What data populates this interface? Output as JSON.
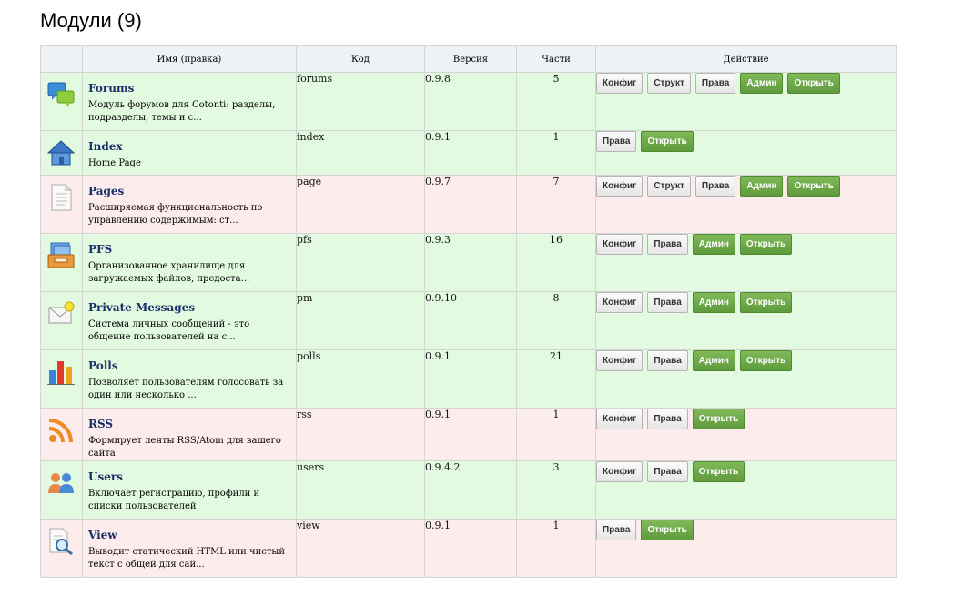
{
  "page_title": "Модули (9)",
  "columns": [
    "Имя (правка)",
    "Код",
    "Версия",
    "Части",
    "Действие"
  ],
  "modules": [
    {
      "name": "Forums",
      "desc": "Модуль форумов для Cotonti: разделы, подразделы, темы и с...",
      "code": "forums",
      "version": "0.9.8",
      "parts": "5",
      "status": "g",
      "icon": "forums-icon",
      "actions": [
        {
          "label": "Конфиг",
          "style": "gray"
        },
        {
          "label": "Структ",
          "style": "gray"
        },
        {
          "label": "Права",
          "style": "gray"
        },
        {
          "label": "Админ",
          "style": "green"
        },
        {
          "label": "Открыть",
          "style": "green"
        }
      ]
    },
    {
      "name": "Index",
      "desc": "Home Page",
      "code": "index",
      "version": "0.9.1",
      "parts": "1",
      "status": "g",
      "icon": "home-icon",
      "actions": [
        {
          "label": "Права",
          "style": "gray"
        },
        {
          "label": "Открыть",
          "style": "green"
        }
      ]
    },
    {
      "name": "Pages",
      "desc": "Расширяемая функциональность по управлению содержимым: ст...",
      "code": "page",
      "version": "0.9.7",
      "parts": "7",
      "status": "r",
      "icon": "page-icon",
      "actions": [
        {
          "label": "Конфиг",
          "style": "gray"
        },
        {
          "label": "Структ",
          "style": "gray"
        },
        {
          "label": "Права",
          "style": "gray"
        },
        {
          "label": "Админ",
          "style": "green"
        },
        {
          "label": "Открыть",
          "style": "green"
        }
      ]
    },
    {
      "name": "PFS",
      "desc": "Организованное хранилище для загружаемых файлов, предоста...",
      "code": "pfs",
      "version": "0.9.3",
      "parts": "16",
      "status": "g",
      "icon": "file-storage-icon",
      "actions": [
        {
          "label": "Конфиг",
          "style": "gray"
        },
        {
          "label": "Права",
          "style": "gray"
        },
        {
          "label": "Админ",
          "style": "green"
        },
        {
          "label": "Открыть",
          "style": "green"
        }
      ]
    },
    {
      "name": "Private Messages",
      "desc": "Система личных сообщений - это общение пользователей на с...",
      "code": "pm",
      "version": "0.9.10",
      "parts": "8",
      "status": "g",
      "icon": "envelope-icon",
      "actions": [
        {
          "label": "Конфиг",
          "style": "gray"
        },
        {
          "label": "Права",
          "style": "gray"
        },
        {
          "label": "Админ",
          "style": "green"
        },
        {
          "label": "Открыть",
          "style": "green"
        }
      ]
    },
    {
      "name": "Polls",
      "desc": "Позволяет пользователям голосовать за один или несколько ...",
      "code": "polls",
      "version": "0.9.1",
      "parts": "21",
      "status": "g",
      "icon": "bar-chart-icon",
      "actions": [
        {
          "label": "Конфиг",
          "style": "gray"
        },
        {
          "label": "Права",
          "style": "gray"
        },
        {
          "label": "Админ",
          "style": "green"
        },
        {
          "label": "Открыть",
          "style": "green"
        }
      ]
    },
    {
      "name": "RSS",
      "desc": "Формирует ленты RSS/Atom для вашего сайта",
      "code": "rss",
      "version": "0.9.1",
      "parts": "1",
      "status": "r",
      "icon": "rss-icon",
      "actions": [
        {
          "label": "Конфиг",
          "style": "gray"
        },
        {
          "label": "Права",
          "style": "gray"
        },
        {
          "label": "Открыть",
          "style": "green"
        }
      ]
    },
    {
      "name": "Users",
      "desc": "Включает регистрацию, профили и списки пользователей",
      "code": "users",
      "version": "0.9.4.2",
      "parts": "3",
      "status": "g",
      "icon": "users-icon",
      "actions": [
        {
          "label": "Конфиг",
          "style": "gray"
        },
        {
          "label": "Права",
          "style": "gray"
        },
        {
          "label": "Открыть",
          "style": "green"
        }
      ]
    },
    {
      "name": "View",
      "desc": "Выводит статический HTML или чистый текст с общей для сай...",
      "code": "view",
      "version": "0.9.1",
      "parts": "1",
      "status": "r",
      "icon": "magnifier-document-icon",
      "actions": [
        {
          "label": "Права",
          "style": "gray"
        },
        {
          "label": "Открыть",
          "style": "green"
        }
      ]
    }
  ]
}
